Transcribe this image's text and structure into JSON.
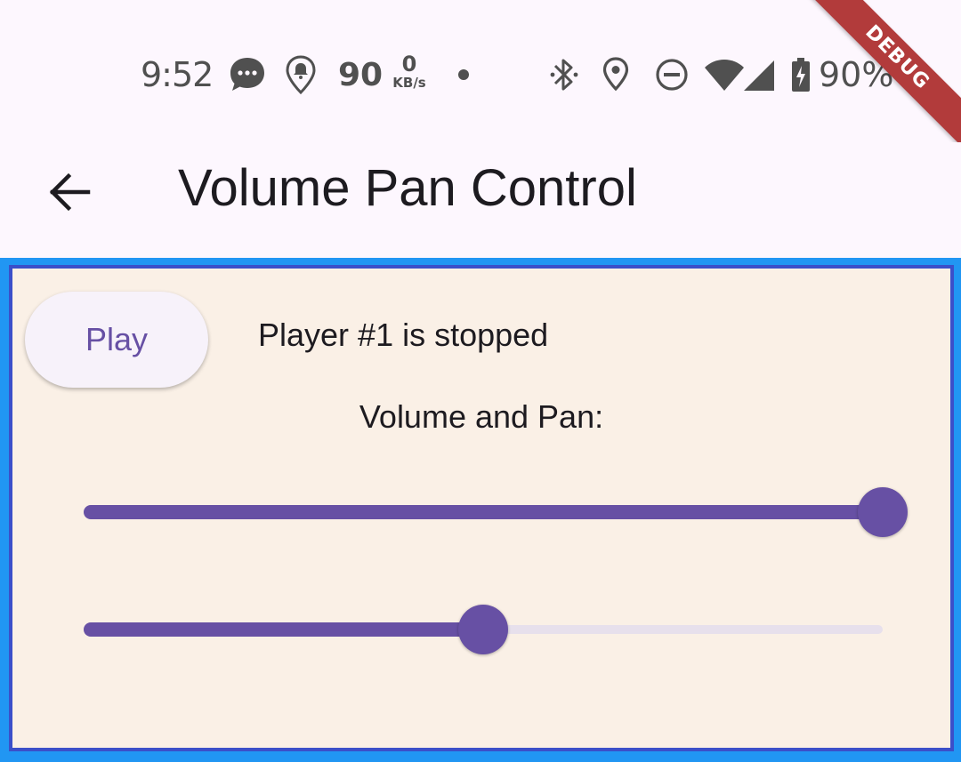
{
  "status_bar": {
    "time": "9:52",
    "notification_count": "90",
    "net_speed_value": "0",
    "net_speed_unit": "KB/s",
    "battery_text": "90%",
    "icons": [
      "chat-bubble-icon",
      "location-alert-icon",
      "dot-icon",
      "bluetooth-icon",
      "location-pin-icon",
      "do-not-disturb-icon",
      "wifi-icon",
      "cell-signal-icon",
      "battery-charging-icon"
    ]
  },
  "debug_banner": "DEBUG",
  "app_bar": {
    "title": "Volume Pan Control",
    "back_icon": "back-arrow-icon"
  },
  "content": {
    "play_label": "Play",
    "player_status": "Player #1 is stopped",
    "volume_pan_label": "Volume and Pan:",
    "volume_slider": {
      "value": 1.0
    },
    "pan_slider": {
      "value": 0.5
    }
  },
  "colors": {
    "accent": "#6750a4",
    "panel_background": "#faf0e6",
    "panel_border_outer": "#2196f3",
    "panel_border_inner": "#3b4fc9",
    "debug_banner": "#b23b3b",
    "surface": "#fdf7fe"
  }
}
